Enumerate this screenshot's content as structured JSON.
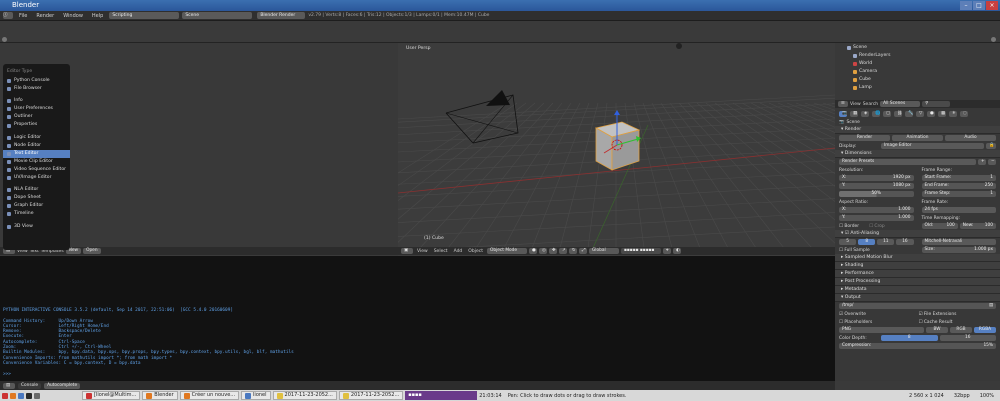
{
  "window": {
    "title": "Blender"
  },
  "menubar": {
    "items": [
      "File",
      "Render",
      "Window",
      "Help"
    ],
    "layout": "Scripting",
    "scene": "Scene",
    "engine": "Blender Render",
    "stats": "v2.79 | Verts:8 | Faces:6 | Tris:12 | Objects:1/3 | Lamps:0/1 | Mem:10.47M | Cube"
  },
  "editor_menu": {
    "title": "Editor Type",
    "items": [
      {
        "label": "Python Console",
        "active": false
      },
      {
        "label": "File Browser",
        "active": false
      },
      {
        "label": "Info",
        "active": false
      },
      {
        "label": "User Preferences",
        "active": false
      },
      {
        "label": "Outliner",
        "active": false
      },
      {
        "label": "Properties",
        "active": false
      },
      {
        "label": "Logic Editor",
        "active": false
      },
      {
        "label": "Node Editor",
        "active": false
      },
      {
        "label": "Text Editor",
        "active": true
      },
      {
        "label": "Movie Clip Editor",
        "active": false
      },
      {
        "label": "Video Sequence Editor",
        "active": false
      },
      {
        "label": "UV/Image Editor",
        "active": false
      },
      {
        "label": "NLA Editor",
        "active": false
      },
      {
        "label": "Dope Sheet",
        "active": false
      },
      {
        "label": "Graph Editor",
        "active": false
      },
      {
        "label": "Timeline",
        "active": false
      },
      {
        "label": "3D View",
        "active": false
      }
    ]
  },
  "text_editor_bar": {
    "items": [
      "View",
      "Text",
      "Templates"
    ],
    "new": "New",
    "open": "Open"
  },
  "viewport": {
    "label": "User Persp",
    "object_label": "(1) Cube",
    "header": [
      "View",
      "Select",
      "Add",
      "Object"
    ],
    "mode": "Object Mode",
    "pivot": "Global"
  },
  "console": {
    "lines": [
      "PYTHON INTERACTIVE CONSOLE 3.5.2 (default, Sep 14 2017, 22:51:06)  [GCC 5.4.0 20160609]",
      "",
      "Command History:     Up/Down Arrow",
      "Cursor:              Left/Right Home/End",
      "Remove:              Backspace/Delete",
      "Execute:             Enter",
      "Autocomplete:        Ctrl-Space",
      "Zoom:                Ctrl +/-, Ctrl-Wheel",
      "Builtin Modules:     bpy, bpy.data, bpy.ops, bpy.props, bpy.types, bpy.context, bpy.utils, bgl, blf, mathutils",
      "Convenience Imports: from mathutils import *; from math import *",
      "Convenience Variables: C = bpy.context, D = bpy.data",
      "",
      ">>> "
    ],
    "tabs": [
      "Console",
      "Autocomplete"
    ]
  },
  "outliner": {
    "items": [
      {
        "label": "Scene",
        "color": "#9aa8c8"
      },
      {
        "label": "RenderLayers",
        "color": "#9aa8c8"
      },
      {
        "label": "World",
        "color": "#c44"
      },
      {
        "label": "Camera",
        "color": "#e0a040"
      },
      {
        "label": "Cube",
        "color": "#e0a040"
      },
      {
        "label": "Lamp",
        "color": "#e0a040"
      }
    ],
    "view": "View",
    "search": "Search",
    "scenes": "All Scenes"
  },
  "properties": {
    "scene": "Scene",
    "render": {
      "title": "Render",
      "buttons": [
        "Render",
        "Animation",
        "Audio"
      ],
      "display_label": "Display:",
      "display_value": "Image Editor"
    },
    "dimensions": {
      "title": "Dimensions",
      "presets": "Render Presets",
      "resolution": "Resolution:",
      "res_x": "1920 px",
      "res_y": "1080 px",
      "res_pct": "50%",
      "frame_range": "Frame Range:",
      "start": "1",
      "end": "250",
      "step": "1",
      "aspect": "Aspect Ratio:",
      "asp_x": "1.000",
      "asp_y": "1.000",
      "frame_rate": "Frame Rate:",
      "fps": "24 fps",
      "remap": "Time Remapping:",
      "old": "100",
      "new": "100",
      "border": "Border",
      "crop": "Crop"
    },
    "aa": {
      "title": "Anti-Aliasing",
      "samples": [
        "5",
        "8",
        "11",
        "16"
      ],
      "filter": "Mitchell-Netravali",
      "full": "Full Sample",
      "size": "1.000 px"
    },
    "collapsed": [
      "Sampled Motion Blur",
      "Shading",
      "Performance",
      "Post Processing",
      "Metadata"
    ],
    "output": {
      "title": "Output",
      "path": "/tmp/",
      "overwrite": "Overwrite",
      "extensions": "File Extensions",
      "placeholders": "Placeholders",
      "cache": "Cache Result",
      "format": "PNG",
      "modes": [
        "BW",
        "RGB",
        "RGBA"
      ],
      "depth_label": "Color Depth:",
      "depths": [
        "8",
        "16"
      ],
      "compression": "Compression:",
      "compression_value": "15%"
    }
  },
  "status": {
    "resolution": "2 560 x 1 024",
    "bpp": "32bpp",
    "zoom": "100%"
  },
  "taskbar": {
    "items": [
      {
        "label": "[lionel@Multim...",
        "active": false,
        "color": "#c33"
      },
      {
        "label": "Blender",
        "active": false,
        "color": "#e07820"
      },
      {
        "label": "Créer un nouve...",
        "active": false,
        "color": "#e07820"
      },
      {
        "label": "lionel",
        "active": false,
        "color": "#4a78c0"
      },
      {
        "label": "2017-11-23-2052...",
        "active": false,
        "color": "#e0c040"
      },
      {
        "label": "2017-11-23-2052...",
        "active": false,
        "color": "#e0c040"
      }
    ],
    "clock": "21:03:14",
    "hint": "Pen: Click to draw dots or drag to draw strokes."
  }
}
